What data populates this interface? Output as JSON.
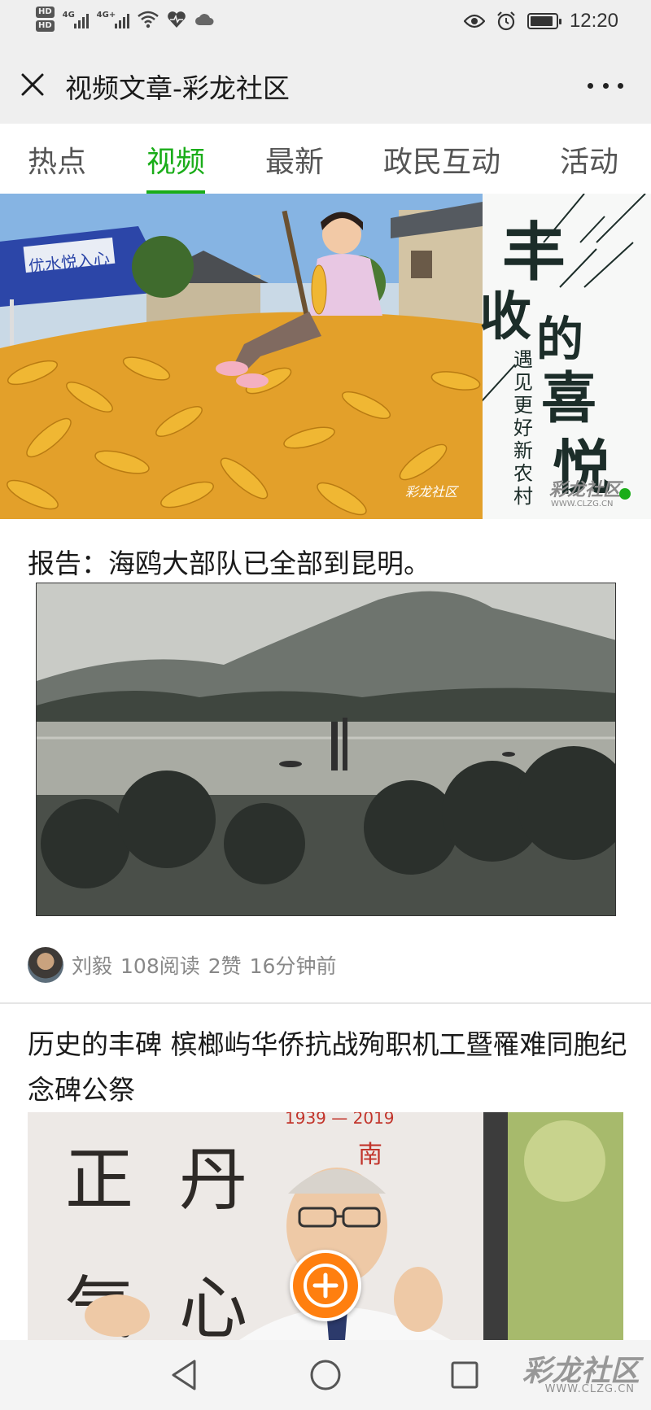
{
  "status_bar": {
    "sim1_badge": "HD",
    "sim2_badge": "HD",
    "sim1_network": "4G",
    "sim2_network": "4G+",
    "battery_level_percent": 90,
    "time": "12:20",
    "icons": [
      "hd-icon",
      "signal-icon",
      "wifi-icon",
      "health-icon",
      "cloud-icon",
      "eye-icon",
      "alarm-icon",
      "battery-icon"
    ]
  },
  "title_bar": {
    "title": "视频文章-彩龙社区",
    "close_icon": "close-icon",
    "more_icon": "more-icon"
  },
  "tabs": [
    {
      "label": "热点",
      "active": false
    },
    {
      "label": "视频",
      "active": true
    },
    {
      "label": "最新",
      "active": false
    },
    {
      "label": "政民互动",
      "active": false
    },
    {
      "label": "活动",
      "active": false
    }
  ],
  "banner": {
    "umbrella_text": "优水悦入心",
    "headline_chars": [
      "丰",
      "收",
      "的",
      "喜",
      "悦"
    ],
    "subtitle": "遇见更好新农村",
    "logo_text": "彩龙社区",
    "logo_url_text": "WWW.CLZG.CN"
  },
  "articles": [
    {
      "title": "报告：海鸥大部队已全部到昆明。",
      "meta": {
        "author": "刘毅",
        "reads": "108阅读",
        "likes": "2赞",
        "time": "16分钟前"
      }
    },
    {
      "title": "历史的丰碑 槟榔屿华侨抗战殉职机工暨罹难同胞纪念碑公祭",
      "image_text": {
        "calligraphy": [
          "正",
          "丹",
          "气",
          "心"
        ],
        "banner_years": "1939 — 2019",
        "banner_char": "南"
      }
    }
  ],
  "fab": {
    "icon": "plus-icon",
    "color": "#ff7f0f"
  },
  "nav_bar": {
    "buttons": [
      "back-icon",
      "home-icon",
      "recents-icon"
    ],
    "watermark": "彩龙社区",
    "watermark_url": "WWW.CLZG.CN"
  },
  "colors": {
    "accent_green": "#1aad19",
    "header_bg": "#efefef",
    "meta_gray": "#888888"
  }
}
